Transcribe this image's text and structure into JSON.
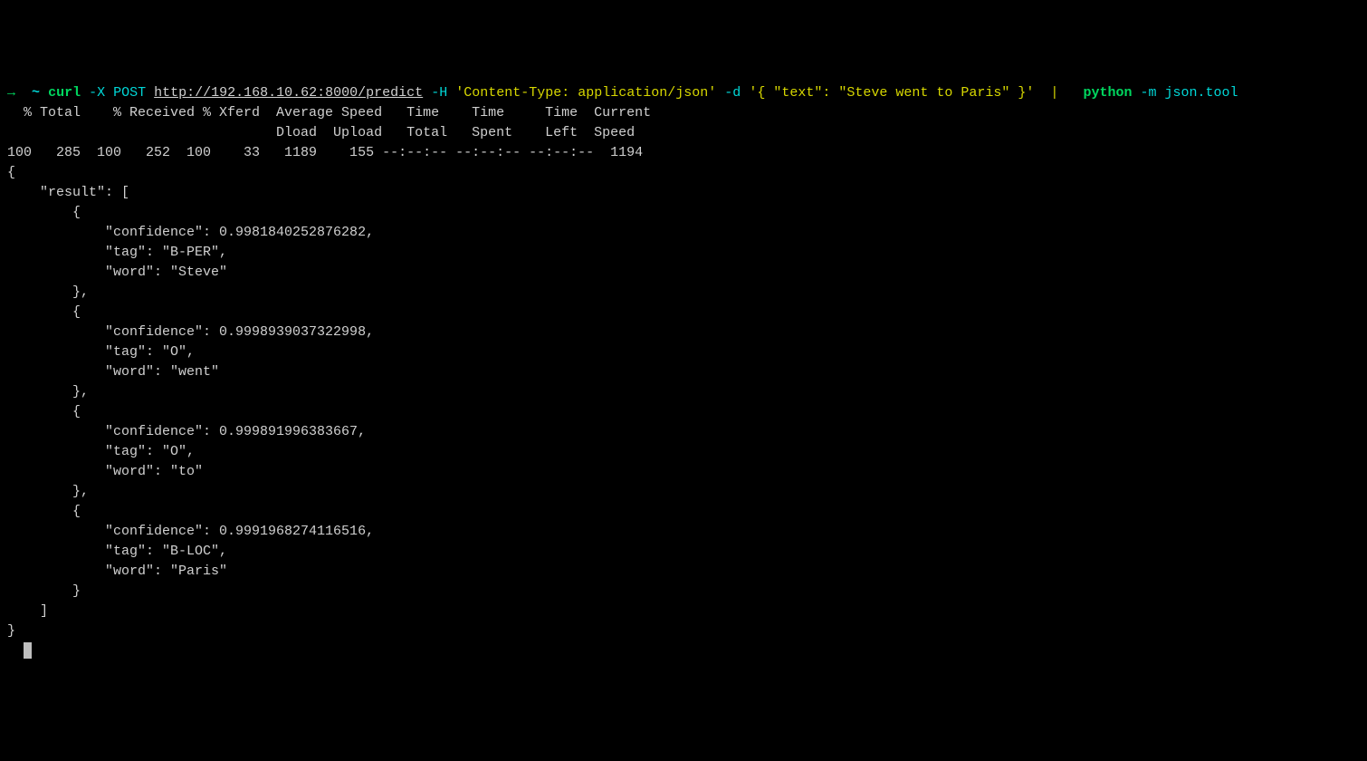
{
  "prompt": {
    "arrow": "→",
    "tilde": "~",
    "cmd": "curl",
    "opts1": "-X POST",
    "url": "http://192.168.10.62:8000/predict",
    "opts2": "-H",
    "arg_header": "'Content-Type: application/json'",
    "opts3": "-d",
    "arg_data": "'{ \"text\": \"Steve went to Paris\" }'",
    "pipe": "|",
    "py_cmd": "python",
    "py_opts": "-m json.tool"
  },
  "curl_header1": "  % Total    % Received % Xferd  Average Speed   Time    Time     Time  Current",
  "curl_header2": "                                 Dload  Upload   Total   Spent    Left  Speed",
  "curl_stats": "100   285  100   252  100    33   1189    155 --:--:-- --:--:-- --:--:--  1194",
  "json_lines": [
    "{",
    "    \"result\": [",
    "        {",
    "            \"confidence\": 0.9981840252876282,",
    "            \"tag\": \"B-PER\",",
    "            \"word\": \"Steve\"",
    "        },",
    "        {",
    "            \"confidence\": 0.9998939037322998,",
    "            \"tag\": \"O\",",
    "            \"word\": \"went\"",
    "        },",
    "        {",
    "            \"confidence\": 0.999891996383667,",
    "            \"tag\": \"O\",",
    "            \"word\": \"to\"",
    "        },",
    "        {",
    "            \"confidence\": 0.9991968274116516,",
    "            \"tag\": \"B-LOC\",",
    "            \"word\": \"Paris\"",
    "        }",
    "    ]",
    "}"
  ]
}
